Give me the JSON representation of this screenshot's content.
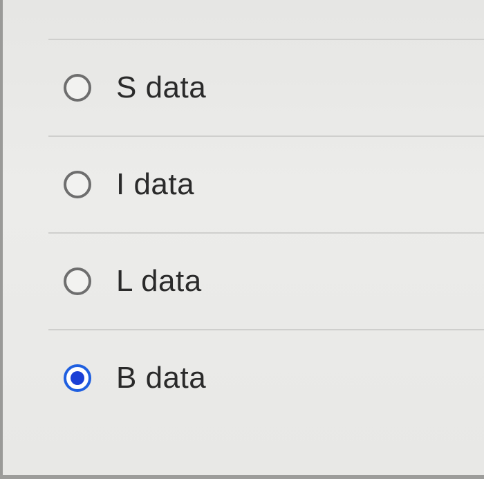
{
  "question": {
    "options": [
      {
        "label": "S data",
        "selected": false
      },
      {
        "label": "I data",
        "selected": false
      },
      {
        "label": "L data",
        "selected": false
      },
      {
        "label": "B data",
        "selected": true
      }
    ],
    "selected_option": "B data"
  },
  "colors": {
    "radio_selected": "#1a3fd6",
    "radio_unselected_border": "#6e6e6e",
    "text": "#2a2a2a",
    "divider": "#cfcfcd"
  }
}
